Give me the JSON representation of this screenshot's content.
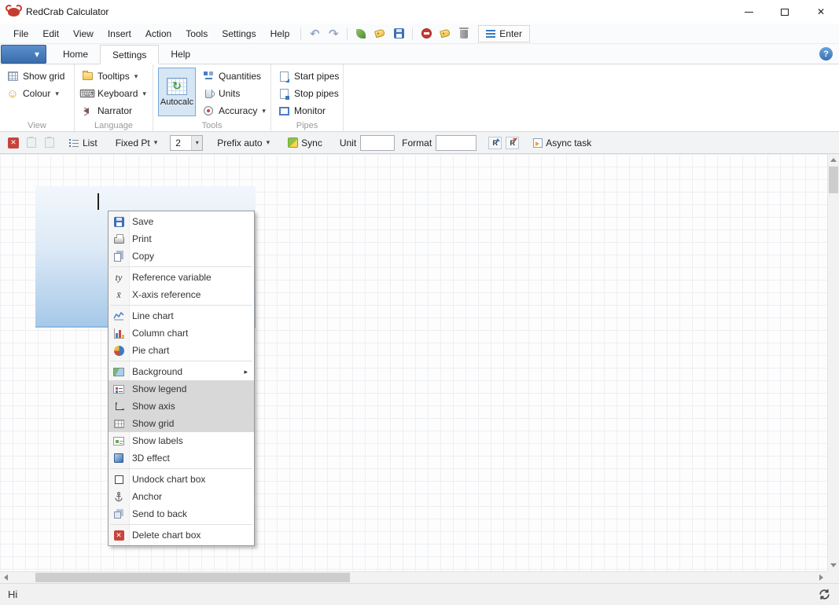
{
  "window": {
    "title": "RedCrab Calculator"
  },
  "icons": {
    "close": "✕",
    "dropdown": "▾",
    "submenu": "▸",
    "undo": "↶",
    "redo": "↷",
    "help": "?",
    "smiley": "☺",
    "keyboard": "⌨",
    "ref_var": "ty",
    "x_axis": "x̄"
  },
  "menubar": {
    "items": [
      "File",
      "Edit",
      "View",
      "Insert",
      "Action",
      "Tools",
      "Settings",
      "Help"
    ],
    "enter_label": "Enter"
  },
  "tabs": {
    "home": "Home",
    "settings": "Settings",
    "help": "Help"
  },
  "ribbon": {
    "view": {
      "label": "View",
      "show_grid": "Show grid",
      "colour": "Colour"
    },
    "language": {
      "label": "Language",
      "tooltips": "Tooltips",
      "keyboard": "Keyboard",
      "narrator": "Narrator"
    },
    "tools": {
      "label": "Tools",
      "autocalc": "Autocalc",
      "quantities": "Quantities",
      "units": "Units",
      "accuracy": "Accuracy"
    },
    "pipes": {
      "label": "Pipes",
      "start": "Start pipes",
      "stop": "Stop pipes",
      "monitor": "Monitor"
    }
  },
  "toolbar": {
    "list": "List",
    "fixed_pt": "Fixed Pt",
    "precision": "2",
    "prefix": "Prefix auto",
    "sync": "Sync",
    "unit": "Unit",
    "unit_value": "",
    "format": "Format",
    "format_value": "",
    "async_task": "Async task"
  },
  "context_menu": {
    "items": [
      {
        "label": "Save"
      },
      {
        "label": "Print"
      },
      {
        "label": "Copy"
      },
      {
        "label": "Reference variable"
      },
      {
        "label": "X-axis reference"
      },
      {
        "label": "Line chart"
      },
      {
        "label": "Column chart"
      },
      {
        "label": "Pie chart"
      },
      {
        "label": "Background",
        "submenu": true
      },
      {
        "label": "Show legend",
        "checked": true
      },
      {
        "label": "Show axis",
        "checked": true
      },
      {
        "label": "Show grid",
        "checked": true
      },
      {
        "label": "Show labels"
      },
      {
        "label": "3D effect"
      },
      {
        "label": "Undock chart box"
      },
      {
        "label": "Anchor"
      },
      {
        "label": "Send to back"
      },
      {
        "label": "Delete chart box"
      }
    ]
  },
  "statusbar": {
    "text": "Hi"
  }
}
